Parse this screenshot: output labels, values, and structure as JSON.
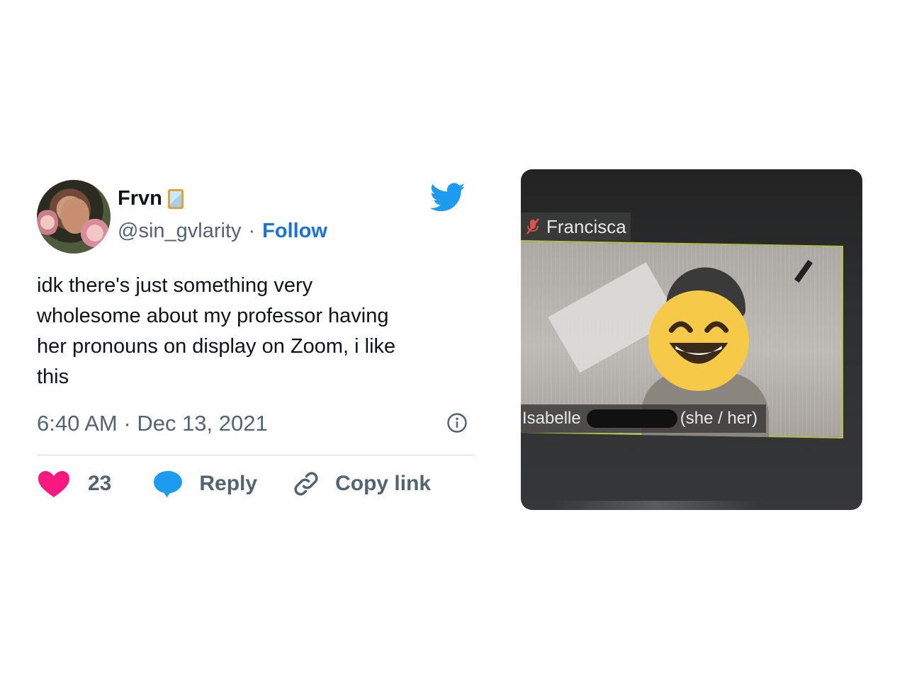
{
  "author": {
    "name": "Frvn",
    "handle": "@sin_gvlarity",
    "separator": "·",
    "follow_label": "Follow",
    "badge_icon": "mirror-icon"
  },
  "tweet": {
    "text_lines": [
      "idk there's just something very",
      "wholesome about my professor having",
      "her pronouns on display on Zoom, i like",
      "this"
    ],
    "time": "6:40 AM",
    "date_separator": "·",
    "date": "Dec 13, 2021"
  },
  "actions": {
    "like_count": "23",
    "reply_label": "Reply",
    "copy_link_label": "Copy link"
  },
  "photo": {
    "top_participant": "Francisca",
    "bottom_participant_first": "Isabelle",
    "bottom_participant_pronouns": "(she / her)"
  },
  "colors": {
    "follow": "#1d72d6",
    "like": "#f91880",
    "reply": "#1d9bf0",
    "twitter": "#1d9bf0",
    "muted": "#536471"
  }
}
